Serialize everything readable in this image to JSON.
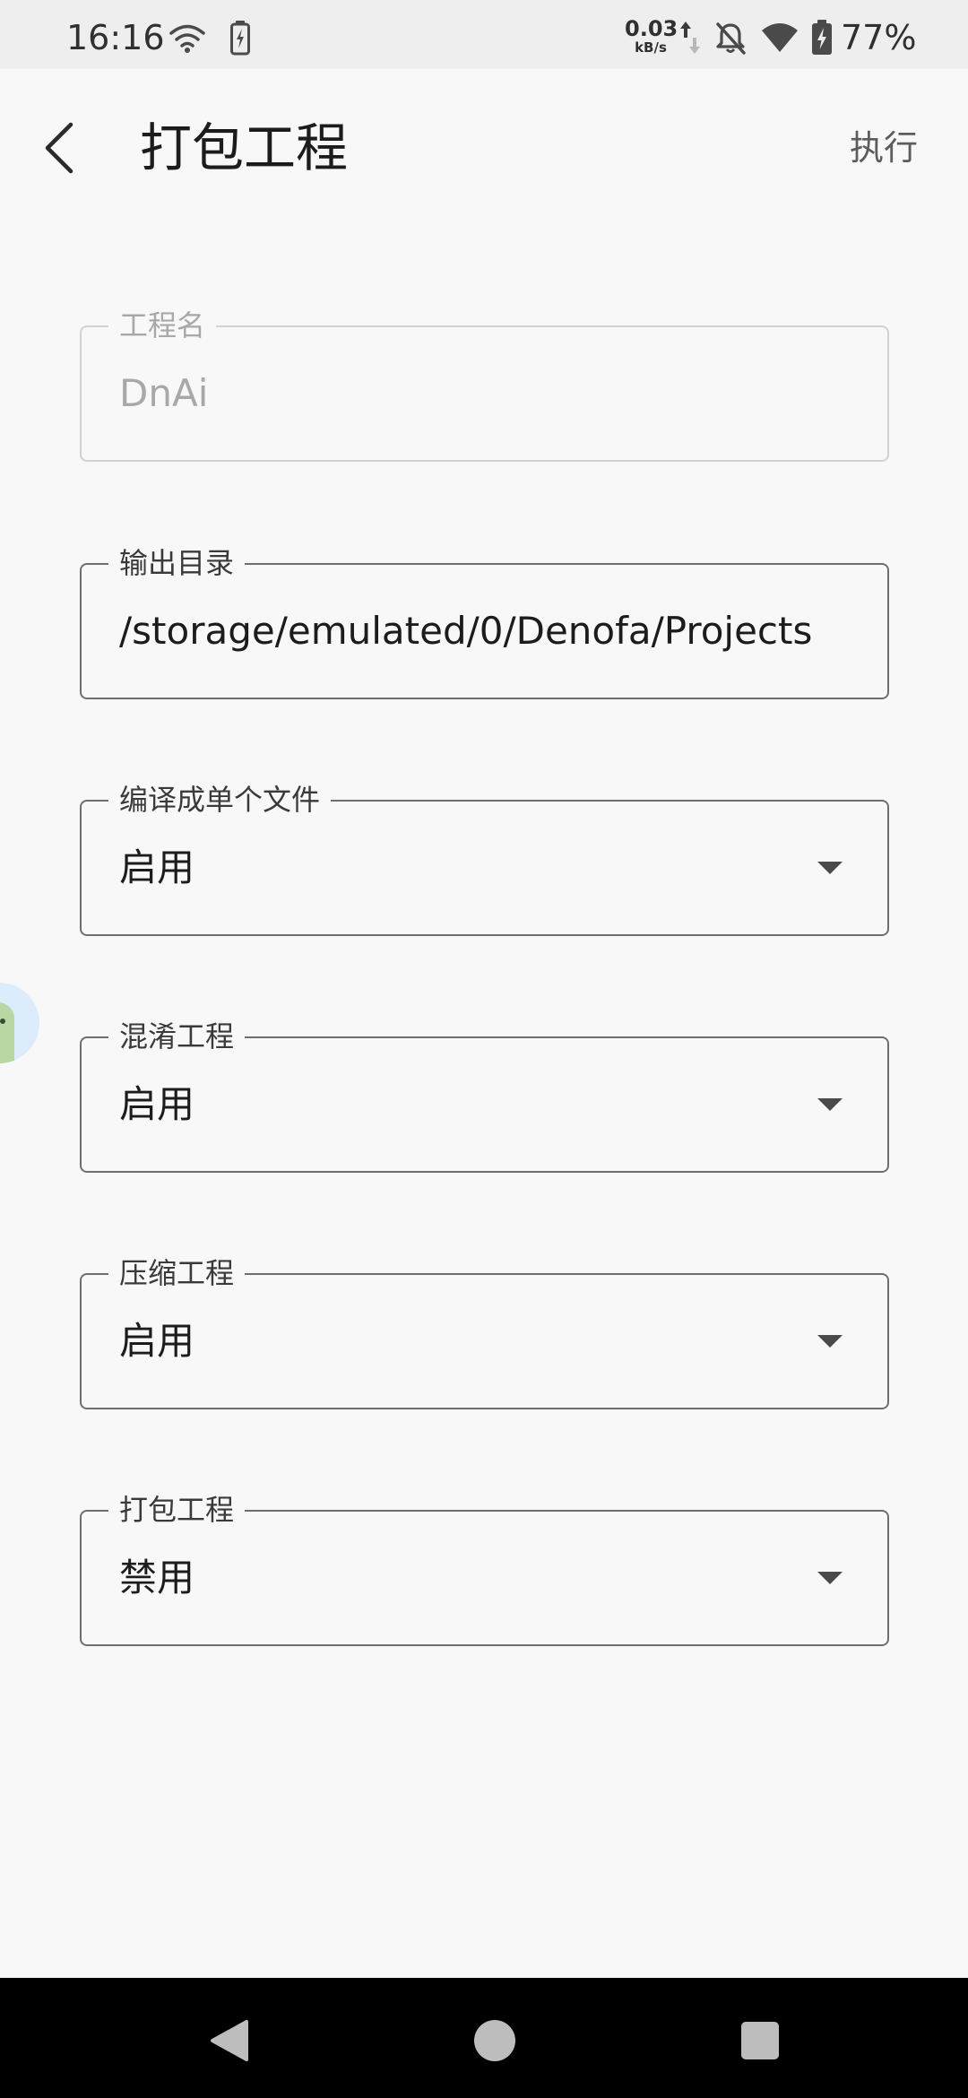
{
  "status_bar": {
    "time": "16:16",
    "net_speed_value": "0.03",
    "net_speed_unit": "kB/s",
    "battery_percent": "77%",
    "icons": [
      "wifi-signal-icon",
      "battery-saver-icon",
      "upload-download-icon",
      "notifications-off-icon",
      "wifi-icon",
      "battery-icon"
    ]
  },
  "header": {
    "title": "打包工程",
    "action_label": "执行",
    "back_icon": "chevron-left-icon"
  },
  "fields": {
    "project_name": {
      "label": "工程名",
      "value": "DnAi",
      "disabled": true
    },
    "output_dir": {
      "label": "输出目录",
      "value": "/storage/emulated/0/Denofa/Projects"
    },
    "single_file": {
      "label": "编译成单个文件",
      "value": "启用"
    },
    "obfuscate": {
      "label": "混淆工程",
      "value": "启用"
    },
    "compress": {
      "label": "压缩工程",
      "value": "启用"
    },
    "package": {
      "label": "打包工程",
      "value": "禁用"
    }
  },
  "colors": {
    "background": "#f8f8f8",
    "status_bar": "#eeeeee",
    "outline": "#6e6e6e",
    "outline_disabled": "#d2d2d2",
    "text_disabled": "#a8a8a8",
    "nav_bar": "#000000",
    "nav_icons": "#bdbdbd"
  },
  "nav_bar": {
    "icons": [
      "nav-back-icon",
      "nav-home-icon",
      "nav-recents-icon"
    ]
  }
}
